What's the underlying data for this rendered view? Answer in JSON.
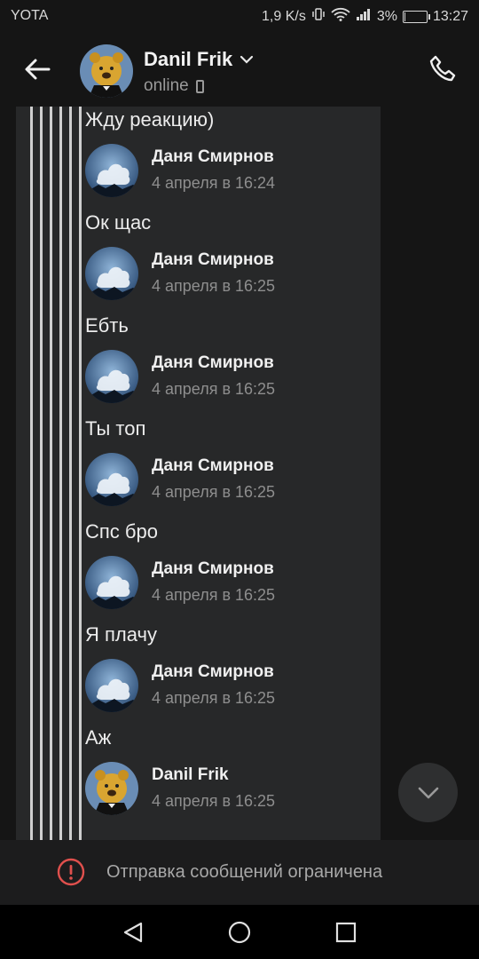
{
  "status_bar": {
    "carrier": "YOTA",
    "speed": "1,9 K/s",
    "battery": "3%",
    "battery_level": 0.03,
    "time": "13:27"
  },
  "header": {
    "contact_name": "Danil Frik",
    "status": "online",
    "back_icon": "arrow-left-icon",
    "call_icon": "phone-icon",
    "dropdown_icon": "chevron-down-icon"
  },
  "messages": [
    {
      "kind": "text",
      "text": "Жду реакцию)"
    },
    {
      "kind": "header",
      "author": "Даня Смирнов",
      "date": "4 апреля в 16:24",
      "avatar": "cloud"
    },
    {
      "kind": "text",
      "text": "Ок щас"
    },
    {
      "kind": "header",
      "author": "Даня Смирнов",
      "date": "4 апреля в 16:25",
      "avatar": "cloud"
    },
    {
      "kind": "text",
      "text": "Ебть"
    },
    {
      "kind": "header",
      "author": "Даня Смирнов",
      "date": "4 апреля в 16:25",
      "avatar": "cloud"
    },
    {
      "kind": "text",
      "text": "Ты топ"
    },
    {
      "kind": "header",
      "author": "Даня Смирнов",
      "date": "4 апреля в 16:25",
      "avatar": "cloud"
    },
    {
      "kind": "text",
      "text": "Спс бро"
    },
    {
      "kind": "header",
      "author": "Даня Смирнов",
      "date": "4 апреля в 16:25",
      "avatar": "cloud"
    },
    {
      "kind": "text",
      "text": "Я плачу"
    },
    {
      "kind": "header",
      "author": "Даня Смирнов",
      "date": "4 апреля в 16:25",
      "avatar": "cloud"
    },
    {
      "kind": "text",
      "text": "Аж"
    },
    {
      "kind": "header",
      "author": "Danil Frik",
      "date": "4 апреля в 16:25",
      "avatar": "pooh"
    }
  ],
  "restricted_banner": {
    "text": "Отправка сообщений ограничена",
    "icon": "exclamation-circle-icon"
  },
  "colors": {
    "background": "#151515",
    "panel": "#272829",
    "warning_red": "#e0504d",
    "muted_text": "#8e8e8e"
  }
}
